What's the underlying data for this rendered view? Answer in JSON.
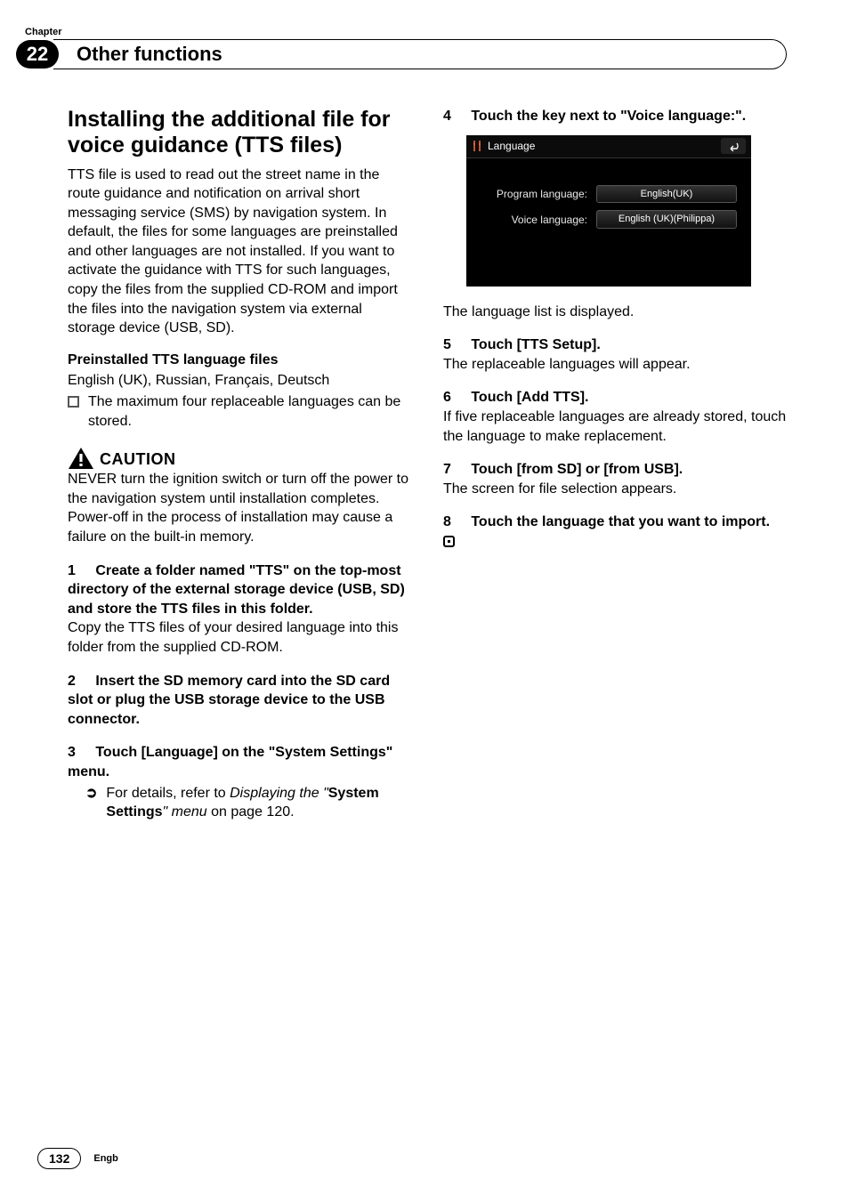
{
  "chapter": {
    "label": "Chapter",
    "number": "22",
    "title": "Other functions"
  },
  "left": {
    "heading": "Installing the additional file for voice guidance (TTS files)",
    "intro": "TTS file is used to read out the street name in the route guidance and notification on arrival short messaging service (SMS) by navigation system. In default, the files for some languages are preinstalled and other languages are not installed. If you want to activate the guidance with TTS for such languages, copy the files from the supplied CD-ROM and import the files into the navigation system via external storage device (USB, SD).",
    "preinstalled_title": "Preinstalled TTS language files",
    "preinstalled_list": "English (UK), Russian, Français, Deutsch",
    "bullet1": "The maximum four replaceable languages can be stored.",
    "caution_label": "CAUTION",
    "caution_text": "NEVER turn the ignition switch or turn off the power to the navigation system until installation completes. Power-off in the process of installation may cause a failure on the built-in memory.",
    "step1_num": "1",
    "step1_head": "Create a folder named \"TTS\" on the top-most directory of the external storage device (USB, SD) and store the TTS files in this folder.",
    "step1_body": "Copy the TTS files of your desired language into this folder from the supplied CD-ROM.",
    "step2_num": "2",
    "step2_head": "Insert the SD memory card into the SD card slot or plug the USB storage device to the USB connector.",
    "step3_num": "3",
    "step3_head": "Touch [Language] on the \"System Settings\" menu.",
    "step3_ref_prefix": "For details, refer to ",
    "step3_ref_em1": "Displaying the \"",
    "step3_ref_bold": "System Settings",
    "step3_ref_em2": "\" menu",
    "step3_ref_tail": " on page 120."
  },
  "right": {
    "step4_num": "4",
    "step4_head": "Touch the key next to \"Voice language:\".",
    "screenshot": {
      "title": "Language",
      "row1_label": "Program language:",
      "row1_value": "English(UK)",
      "row2_label": "Voice language:",
      "row2_value": "English (UK)(Philippa)"
    },
    "after_ss": "The language list is displayed.",
    "step5_num": "5",
    "step5_head": "Touch [TTS Setup].",
    "step5_body": "The replaceable languages will appear.",
    "step6_num": "6",
    "step6_head": "Touch [Add TTS].",
    "step6_body": "If five replaceable languages are already stored, touch the language to make replacement.",
    "step7_num": "7",
    "step7_head": "Touch [from SD] or [from USB].",
    "step7_body": "The screen for file selection appears.",
    "step8_num": "8",
    "step8_head": "Touch the language that you want to import."
  },
  "footer": {
    "page": "132",
    "lang": "Engb"
  }
}
